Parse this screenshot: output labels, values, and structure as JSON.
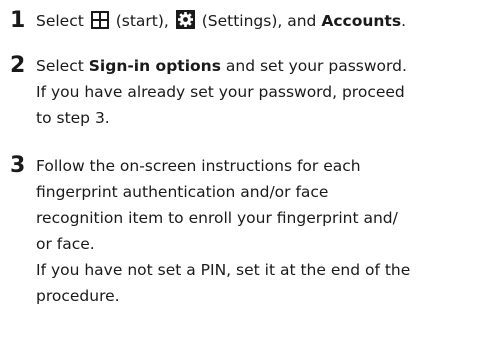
{
  "step1": {
    "number": "1",
    "text_a": "Select",
    "start_icon": "windows-start-icon",
    "text_b": "(start),",
    "settings_icon": "settings-gear-icon",
    "text_c": "(Settings), and",
    "accounts": "Accounts",
    "period": "."
  },
  "step2": {
    "number": "2",
    "text_a": "Select",
    "sign_in_options": "Sign-in options",
    "text_b": "and set your password.",
    "line2": "If you have already set your password, proceed",
    "line3": "to step 3."
  },
  "step3": {
    "number": "3",
    "lines": [
      "Follow the on-screen instructions for each",
      "fingerprint authentication and/or face",
      "recognition item to enroll your fingerprint and/",
      "or face.",
      "If you have not set a PIN, set it at the end of the",
      "procedure."
    ]
  }
}
